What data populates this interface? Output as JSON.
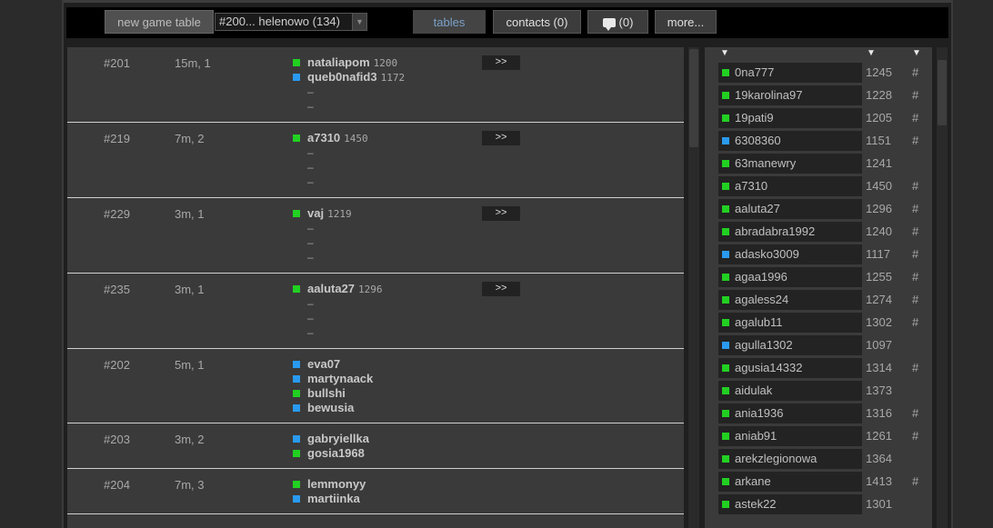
{
  "toolbar": {
    "new_game_label": "new game table",
    "room_select": "#200... helenowo (134)",
    "tables_label": "tables",
    "contacts_label": "contacts (0)",
    "messages_label": "(0)",
    "more_label": "more..."
  },
  "tables": [
    {
      "id": "#201",
      "time": "15m, 1",
      "join": ">>",
      "players": [
        {
          "status": "green",
          "name": "nataliapom",
          "rating": "1200"
        },
        {
          "status": "blue",
          "name": "queb0nafid3",
          "rating": "1172"
        }
      ],
      "empty": [
        "–",
        "–"
      ]
    },
    {
      "id": "#219",
      "time": "7m, 2",
      "join": ">>",
      "players": [
        {
          "status": "green",
          "name": "a7310",
          "rating": "1450"
        }
      ],
      "empty": [
        "–",
        "–",
        "–"
      ]
    },
    {
      "id": "#229",
      "time": "3m, 1",
      "join": ">>",
      "players": [
        {
          "status": "green",
          "name": "vaj",
          "rating": "1219"
        }
      ],
      "empty": [
        "–",
        "–",
        "–"
      ]
    },
    {
      "id": "#235",
      "time": "3m, 1",
      "join": ">>",
      "players": [
        {
          "status": "green",
          "name": "aaluta27",
          "rating": "1296"
        }
      ],
      "empty": [
        "–",
        "–",
        "–"
      ]
    },
    {
      "id": "#202",
      "time": "5m, 1",
      "join": "",
      "players": [
        {
          "status": "blue",
          "name": "eva07",
          "rating": ""
        },
        {
          "status": "blue",
          "name": "martynaack",
          "rating": ""
        },
        {
          "status": "green",
          "name": "bullshi",
          "rating": ""
        },
        {
          "status": "blue",
          "name": "bewusia",
          "rating": ""
        }
      ],
      "empty": []
    },
    {
      "id": "#203",
      "time": "3m, 2",
      "join": "",
      "players": [
        {
          "status": "blue",
          "name": "gabryiellka",
          "rating": ""
        },
        {
          "status": "green",
          "name": "gosia1968",
          "rating": ""
        }
      ],
      "empty": []
    },
    {
      "id": "#204",
      "time": "7m, 3",
      "join": "",
      "players": [
        {
          "status": "green",
          "name": "lemmonyy",
          "rating": ""
        },
        {
          "status": "blue",
          "name": "martiinka",
          "rating": ""
        }
      ],
      "empty": []
    }
  ],
  "users_header": {
    "sort_name": "▼",
    "sort_rating": "▼",
    "sort_hash": "▼"
  },
  "users": [
    {
      "status": "green",
      "name": "0na777",
      "rating": "1245",
      "hash": "#"
    },
    {
      "status": "green",
      "name": "19karolina97",
      "rating": "1228",
      "hash": "#"
    },
    {
      "status": "green",
      "name": "19pati9",
      "rating": "1205",
      "hash": "#"
    },
    {
      "status": "blue",
      "name": "6308360",
      "rating": "1151",
      "hash": "#"
    },
    {
      "status": "green",
      "name": "63manewry",
      "rating": "1241",
      "hash": ""
    },
    {
      "status": "green",
      "name": "a7310",
      "rating": "1450",
      "hash": "#"
    },
    {
      "status": "green",
      "name": "aaluta27",
      "rating": "1296",
      "hash": "#"
    },
    {
      "status": "green",
      "name": "abradabra1992",
      "rating": "1240",
      "hash": "#"
    },
    {
      "status": "blue",
      "name": "adasko3009",
      "rating": "1117",
      "hash": "#"
    },
    {
      "status": "green",
      "name": "agaa1996",
      "rating": "1255",
      "hash": "#"
    },
    {
      "status": "green",
      "name": "agaless24",
      "rating": "1274",
      "hash": "#"
    },
    {
      "status": "green",
      "name": "agalub11",
      "rating": "1302",
      "hash": "#"
    },
    {
      "status": "blue",
      "name": "agulla1302",
      "rating": "1097",
      "hash": ""
    },
    {
      "status": "green",
      "name": "agusia14332",
      "rating": "1314",
      "hash": "#"
    },
    {
      "status": "green",
      "name": "aidulak",
      "rating": "1373",
      "hash": ""
    },
    {
      "status": "green",
      "name": "ania1936",
      "rating": "1316",
      "hash": "#"
    },
    {
      "status": "green",
      "name": "aniab91",
      "rating": "1261",
      "hash": "#"
    },
    {
      "status": "green",
      "name": "arekzlegionowa",
      "rating": "1364",
      "hash": ""
    },
    {
      "status": "green",
      "name": "arkane",
      "rating": "1413",
      "hash": "#"
    },
    {
      "status": "green",
      "name": "astek22",
      "rating": "1301",
      "hash": ""
    }
  ]
}
